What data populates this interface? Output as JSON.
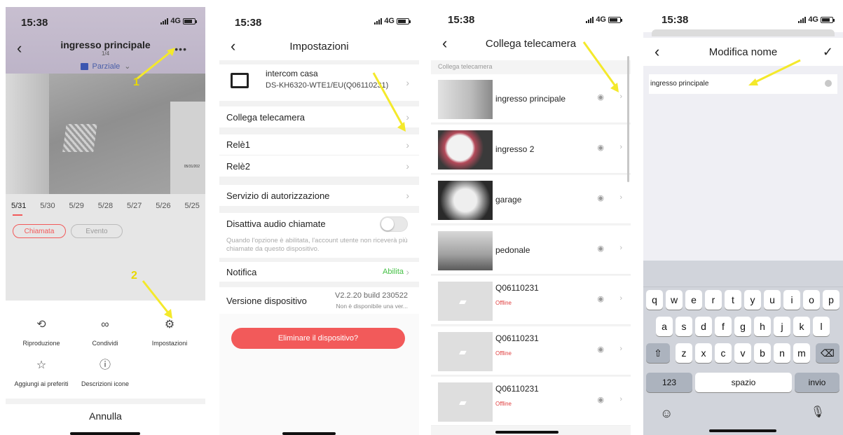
{
  "colors": {
    "accent_red": "#f25a5a",
    "enable_green": "#44c044",
    "arrow_yellow": "#f4e92b"
  },
  "status_bar": {
    "time": "15:38",
    "network": "4G"
  },
  "screen1": {
    "title": "ingresso principale",
    "counter": "1/4",
    "mode": "Parziale",
    "overlay_timestamp": "05/31/202",
    "dates": [
      "5/31",
      "5/30",
      "5/29",
      "5/28",
      "5/27",
      "5/26",
      "5/25"
    ],
    "filters": [
      "Chiamata",
      "Evento"
    ],
    "menu": [
      "Riproduzione",
      "Condividi",
      "Impostazioni",
      "Aggiungi ai preferiti",
      "Descrizioni icone"
    ],
    "cancel": "Annulla",
    "step_1": "1",
    "step_2": "2"
  },
  "screen2": {
    "title": "Impostazioni",
    "device_name": "intercom casa",
    "device_model": "DS-KH6320-WTE1/EU(Q06110231)",
    "link_camera": "Collega telecamera",
    "relay1": "Relè1",
    "relay2": "Relè2",
    "auth_service": "Servizio di autorizzazione",
    "mute_calls": "Disattiva audio chiamate",
    "mute_hint": "Quando l'opzione è abilitata, l'account utente non riceverà più chiamate da questo dispositivo.",
    "notification": "Notifica",
    "notification_value": "Abilita",
    "version_label": "Versione dispositivo",
    "version_value": "V2.2.20 build 230522",
    "version_note": "Non è disponibile una ver...",
    "delete_button": "Eliminare il dispositivo?"
  },
  "screen3": {
    "title": "Collega telecamera",
    "section": "Collega telecamera",
    "cameras": [
      {
        "name": "ingresso principale"
      },
      {
        "name": "ingresso 2"
      },
      {
        "name": "garage"
      },
      {
        "name": "pedonale"
      },
      {
        "name": "Q06110231",
        "status": "Offline"
      },
      {
        "name": "Q06110231",
        "status": "Offline"
      },
      {
        "name": "Q06110231",
        "status": "Offline"
      }
    ]
  },
  "screen4": {
    "title": "Modifica nome",
    "input_value": "ingresso principale",
    "keyboard": {
      "row1": [
        "q",
        "w",
        "e",
        "r",
        "t",
        "y",
        "u",
        "i",
        "o",
        "p"
      ],
      "row2": [
        "a",
        "s",
        "d",
        "f",
        "g",
        "h",
        "j",
        "k",
        "l"
      ],
      "row3": [
        "z",
        "x",
        "c",
        "v",
        "b",
        "n",
        "m"
      ],
      "numbers": "123",
      "space": "spazio",
      "enter": "invio"
    }
  }
}
